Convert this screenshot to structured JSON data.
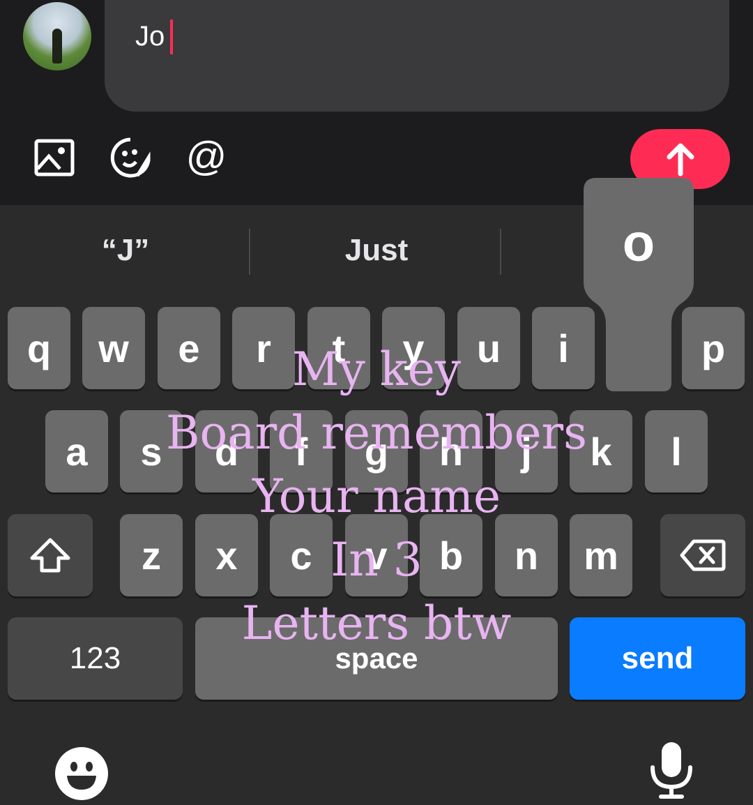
{
  "comment": {
    "text": "Jo"
  },
  "toolbar": {
    "icons": [
      "image-icon",
      "sticker-icon",
      "mention-icon"
    ],
    "send_icon": "arrow-up-icon"
  },
  "suggestions": [
    "“J”",
    "Just"
  ],
  "key_popup": "o",
  "keyboard": {
    "row1": [
      "q",
      "w",
      "e",
      "r",
      "t",
      "y",
      "u",
      "i",
      "p"
    ],
    "row2": [
      "a",
      "s",
      "d",
      "f",
      "g",
      "h",
      "j",
      "k",
      "l"
    ],
    "row3": [
      "z",
      "x",
      "c",
      "v",
      "b",
      "n",
      "m"
    ],
    "numbers_label": "123",
    "space_label": "space",
    "send_label": "send"
  },
  "overlay_text": [
    "My key",
    "Board remembers",
    "Your name",
    "In 3",
    "Letters btw"
  ],
  "colors": {
    "accent_red": "#fe2c55",
    "send_blue": "#0a7cff",
    "overlay_pink": "#e8b4f1"
  }
}
